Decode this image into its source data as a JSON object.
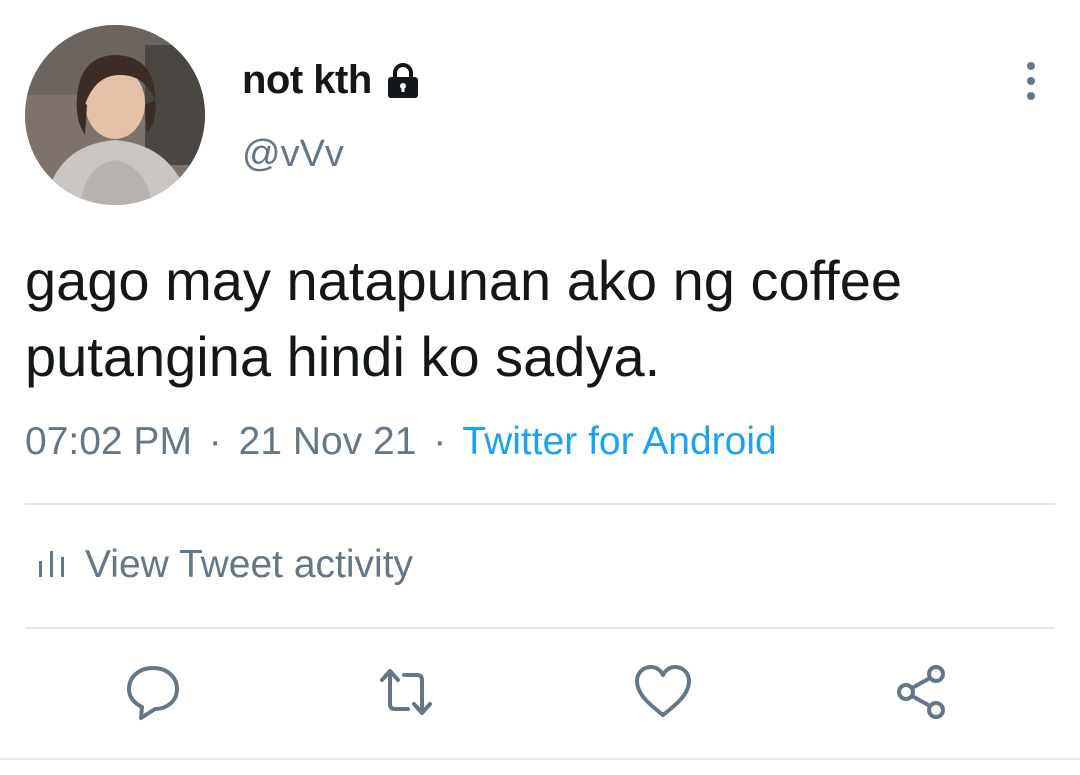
{
  "tweet": {
    "display_name": "not kth",
    "handle": "@vVv",
    "protected_icon": "lock-icon",
    "text_line1": "gago may natapunan ako ng coffee",
    "text_line2": "putangina hindi ko sadya.",
    "time": "07:02 PM",
    "date": "21 Nov 21",
    "separator": "·",
    "source": "Twitter for Android"
  },
  "activity": {
    "label": "View Tweet activity",
    "icon": "bar-chart-icon"
  },
  "actions": {
    "reply_icon": "reply-icon",
    "retweet_icon": "retweet-icon",
    "like_icon": "heart-icon",
    "share_icon": "share-icon"
  },
  "colors": {
    "text": "#14171a",
    "secondary": "#657786",
    "link": "#1da1f2",
    "divider": "#e1e8ed"
  }
}
